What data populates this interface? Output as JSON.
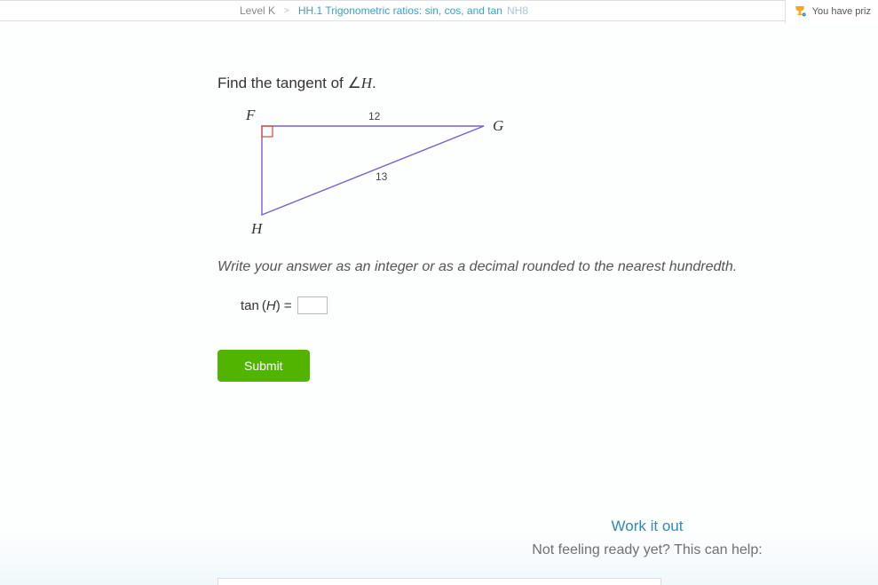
{
  "breadcrumb": {
    "level": "Level K",
    "topic": "HH.1 Trigonometric ratios: sin, cos, and tan",
    "code": "NH8"
  },
  "prize": {
    "text": "You have priz"
  },
  "question": {
    "prefix": "Find the tangent of ",
    "angle_symbol": "∠",
    "angle_vertex": "H",
    "suffix": "."
  },
  "diagram": {
    "vertices": {
      "F": "F",
      "G": "G",
      "H": "H"
    },
    "edges": {
      "FG": "12",
      "GH": "13"
    }
  },
  "instruction": "Write your answer as an integer or as a decimal rounded to the nearest hundredth.",
  "answer": {
    "fn": "tan",
    "lparen": "(",
    "var": "H",
    "rparen": ")",
    "eq": " = ",
    "value": ""
  },
  "submit_label": "Submit",
  "help": {
    "work_it_out": "Work it out",
    "not_ready": "Not feeling ready yet? This can help:"
  }
}
